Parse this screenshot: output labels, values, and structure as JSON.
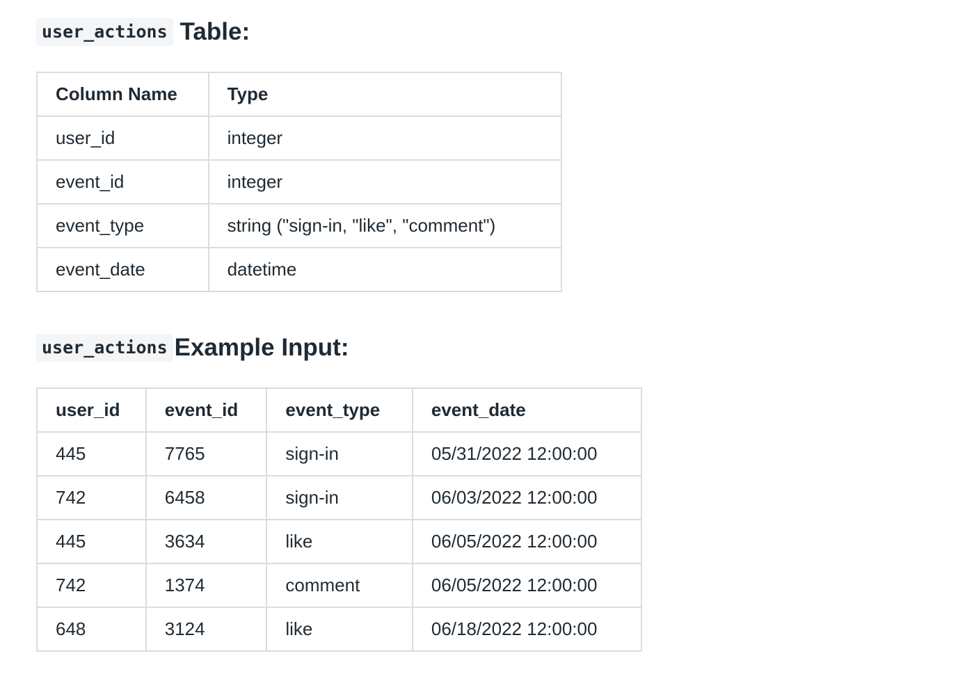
{
  "schema_section": {
    "code": "user_actions",
    "title": "Table:",
    "headers": [
      "Column Name",
      "Type"
    ],
    "rows": [
      [
        "user_id",
        "integer"
      ],
      [
        "event_id",
        "integer"
      ],
      [
        "event_type",
        "string (\"sign-in, \"like\", \"comment\")"
      ],
      [
        "event_date",
        "datetime"
      ]
    ]
  },
  "example_section": {
    "code": "user_actions",
    "title": "Example Input:",
    "headers": [
      "user_id",
      "event_id",
      "event_type",
      "event_date"
    ],
    "rows": [
      [
        "445",
        "7765",
        "sign-in",
        "05/31/2022 12:00:00"
      ],
      [
        "742",
        "6458",
        "sign-in",
        "06/03/2022 12:00:00"
      ],
      [
        "445",
        "3634",
        "like",
        "06/05/2022 12:00:00"
      ],
      [
        "742",
        "1374",
        "comment",
        "06/05/2022 12:00:00"
      ],
      [
        "648",
        "3124",
        "like",
        "06/18/2022 12:00:00"
      ]
    ]
  }
}
